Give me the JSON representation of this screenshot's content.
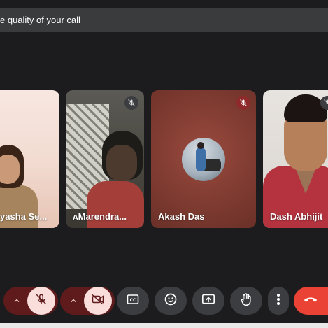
{
  "banner": {
    "text": "e quality of your call"
  },
  "participants": [
    {
      "name": "yasha Se...",
      "muted": false
    },
    {
      "name": "ᴀMarendra...",
      "muted": true
    },
    {
      "name": "Akash Das",
      "muted": true
    },
    {
      "name": "Dash Abhijit",
      "muted": true
    }
  ],
  "colors": {
    "background": "#1c1c1e",
    "banner": "#3a3b3d",
    "mute_badge_dark": "#3c3d40",
    "mute_badge_red": "#8f2a2a",
    "control_dark": "#3c3d40",
    "control_off_bg": "#f9dedc",
    "control_off_pill": "#5f1b1b",
    "end_call": "#ea4335"
  },
  "controls": [
    {
      "icon": "mic-options-chevron-icon"
    },
    {
      "icon": "mic-off-icon",
      "state": "off"
    },
    {
      "icon": "camera-options-chevron-icon"
    },
    {
      "icon": "camera-off-icon",
      "state": "off"
    },
    {
      "icon": "closed-captions-icon"
    },
    {
      "icon": "emoji-reactions-icon"
    },
    {
      "icon": "present-screen-icon"
    },
    {
      "icon": "raise-hand-icon"
    },
    {
      "icon": "more-options-icon"
    },
    {
      "icon": "end-call-icon"
    }
  ]
}
